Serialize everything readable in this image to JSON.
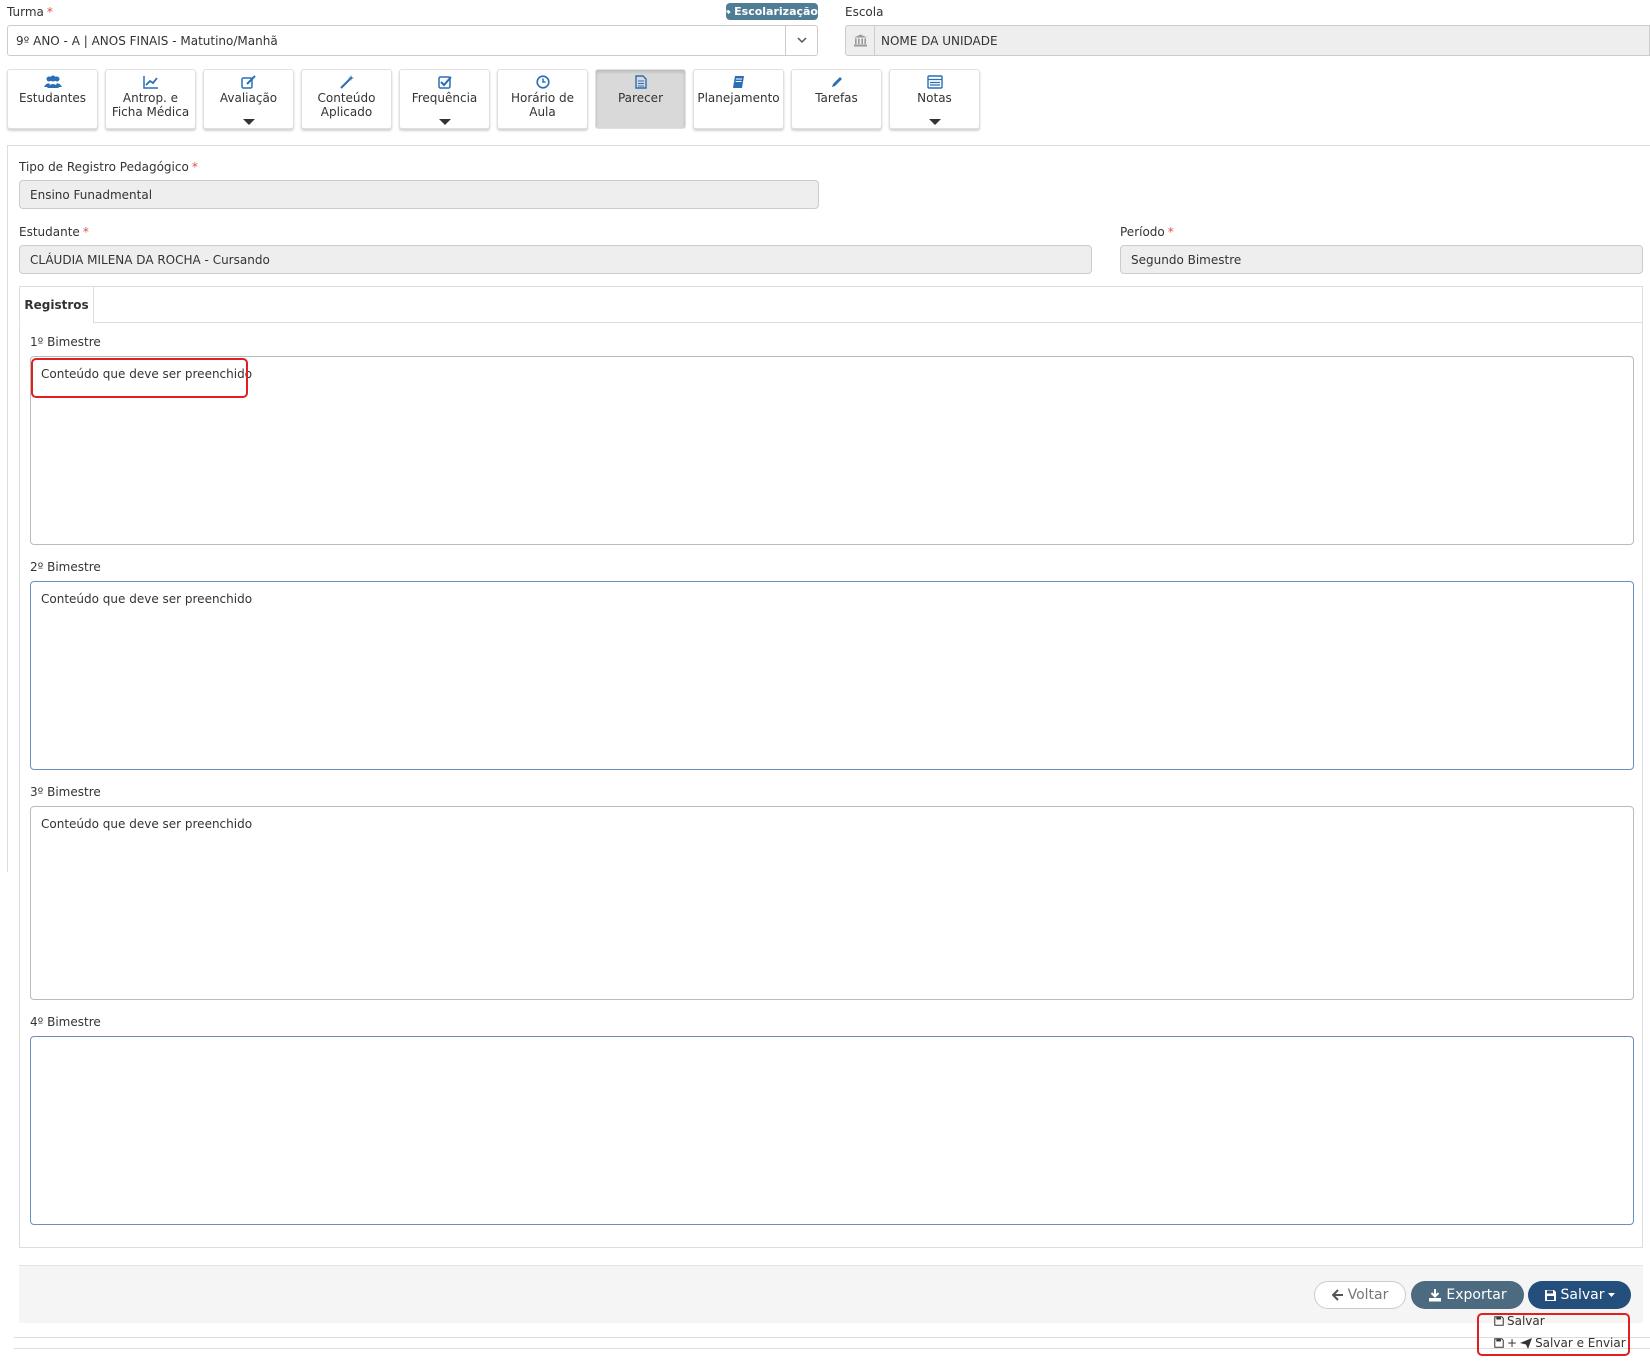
{
  "turma": {
    "label": "Turma",
    "required": "*",
    "value": "9º ANO - A | ANOS FINAIS - Matutino/Manhã",
    "badge": "Escolarização"
  },
  "escola": {
    "label": "Escola",
    "value": "NOME DA UNIDADE"
  },
  "toolbar": {
    "estudantes": {
      "line1": "Estudantes",
      "line2": ""
    },
    "antrop": {
      "line1": "Antrop. e",
      "line2": "Ficha Médica"
    },
    "avaliacao": {
      "line1": "Avaliação",
      "line2": ""
    },
    "conteudo": {
      "line1": "Conteúdo",
      "line2": "Aplicado"
    },
    "frequencia": {
      "line1": "Frequência",
      "line2": ""
    },
    "horario": {
      "line1": "Horário de",
      "line2": "Aula"
    },
    "parecer": {
      "line1": "Parecer",
      "line2": ""
    },
    "planejamento": {
      "line1": "Planejamento",
      "line2": ""
    },
    "tarefas": {
      "line1": "Tarefas",
      "line2": ""
    },
    "notas": {
      "line1": "Notas",
      "line2": ""
    }
  },
  "form": {
    "tipo_label": "Tipo de Registro Pedagógico",
    "tipo_value": "Ensino Funadmental",
    "estudante_label": "Estudante",
    "estudante_value": "CLÁUDIA MILENA DA ROCHA - Cursando",
    "periodo_label": "Período",
    "periodo_value": "Segundo Bimestre",
    "required": "*"
  },
  "tabs": {
    "registros": "Registros"
  },
  "bimestres": [
    {
      "label": "1º Bimestre",
      "content": "Conteúdo que deve ser preenchido"
    },
    {
      "label": "2º Bimestre",
      "content": "Conteúdo que deve ser preenchido"
    },
    {
      "label": "3º Bimestre",
      "content": "Conteúdo que deve ser preenchido"
    },
    {
      "label": "4º Bimestre",
      "content": ""
    }
  ],
  "footer": {
    "voltar": "Voltar",
    "exportar": "Exportar",
    "salvar": "Salvar",
    "menu_salvar": "Salvar",
    "menu_plus": "+",
    "menu_salvar_enviar": "Salvar e Enviar"
  },
  "colors": {
    "accent": "#244e7b",
    "badge": "#4f7d96",
    "highlight": "#e02020",
    "icon": "#2a6eb5"
  }
}
